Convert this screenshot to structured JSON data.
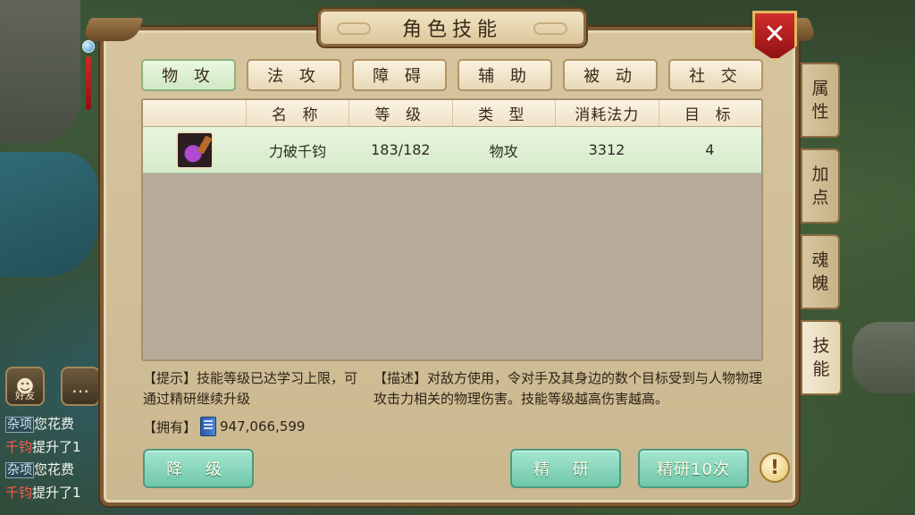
{
  "window": {
    "title": "角色技能",
    "close_icon": "close-icon",
    "close_glyph": "✕"
  },
  "category_tabs": [
    {
      "label": "物 攻",
      "active": true
    },
    {
      "label": "法 攻",
      "active": false
    },
    {
      "label": "障 碍",
      "active": false
    },
    {
      "label": "辅 助",
      "active": false
    },
    {
      "label": "被 动",
      "active": false
    },
    {
      "label": "社 交",
      "active": false
    }
  ],
  "table": {
    "headers": [
      "",
      "名 称",
      "等 级",
      "类 型",
      "消耗法力",
      "目 标"
    ],
    "rows": [
      {
        "icon": "skill-icon",
        "name": "力破千钧",
        "level": "183/182",
        "type": "物攻",
        "mana_cost": "3312",
        "targets": "4"
      }
    ]
  },
  "hint": {
    "text": "【提示】技能等级已达学习上限，可通过精研继续升级"
  },
  "description": {
    "text": "【描述】对敌方使用，令对手及其身边的数个目标受到与人物物理攻击力相关的物理伤害。技能等级越高伤害越高。"
  },
  "own": {
    "label": "【拥有】",
    "icon": "book-icon",
    "value": "947,066,599"
  },
  "buttons": {
    "downgrade": "降 级",
    "refine": "精 研",
    "refine10": "精研10次",
    "help_glyph": "!"
  },
  "side_tabs": [
    {
      "label_top": "属",
      "label_bottom": "性",
      "active": false
    },
    {
      "label_top": "加",
      "label_bottom": "点",
      "active": false
    },
    {
      "label_top": "魂",
      "label_bottom": "魄",
      "active": false
    },
    {
      "label_top": "技",
      "label_bottom": "能",
      "active": true
    }
  ],
  "hud": {
    "friends_label": "好友",
    "chat_lines": [
      {
        "tag": "杂项",
        "text": "您花费"
      },
      {
        "tag": "千钧",
        "text": "提升了1"
      },
      {
        "tag": "杂项",
        "text": "您花费"
      },
      {
        "tag": "千钧",
        "text": "提升了1"
      }
    ]
  }
}
